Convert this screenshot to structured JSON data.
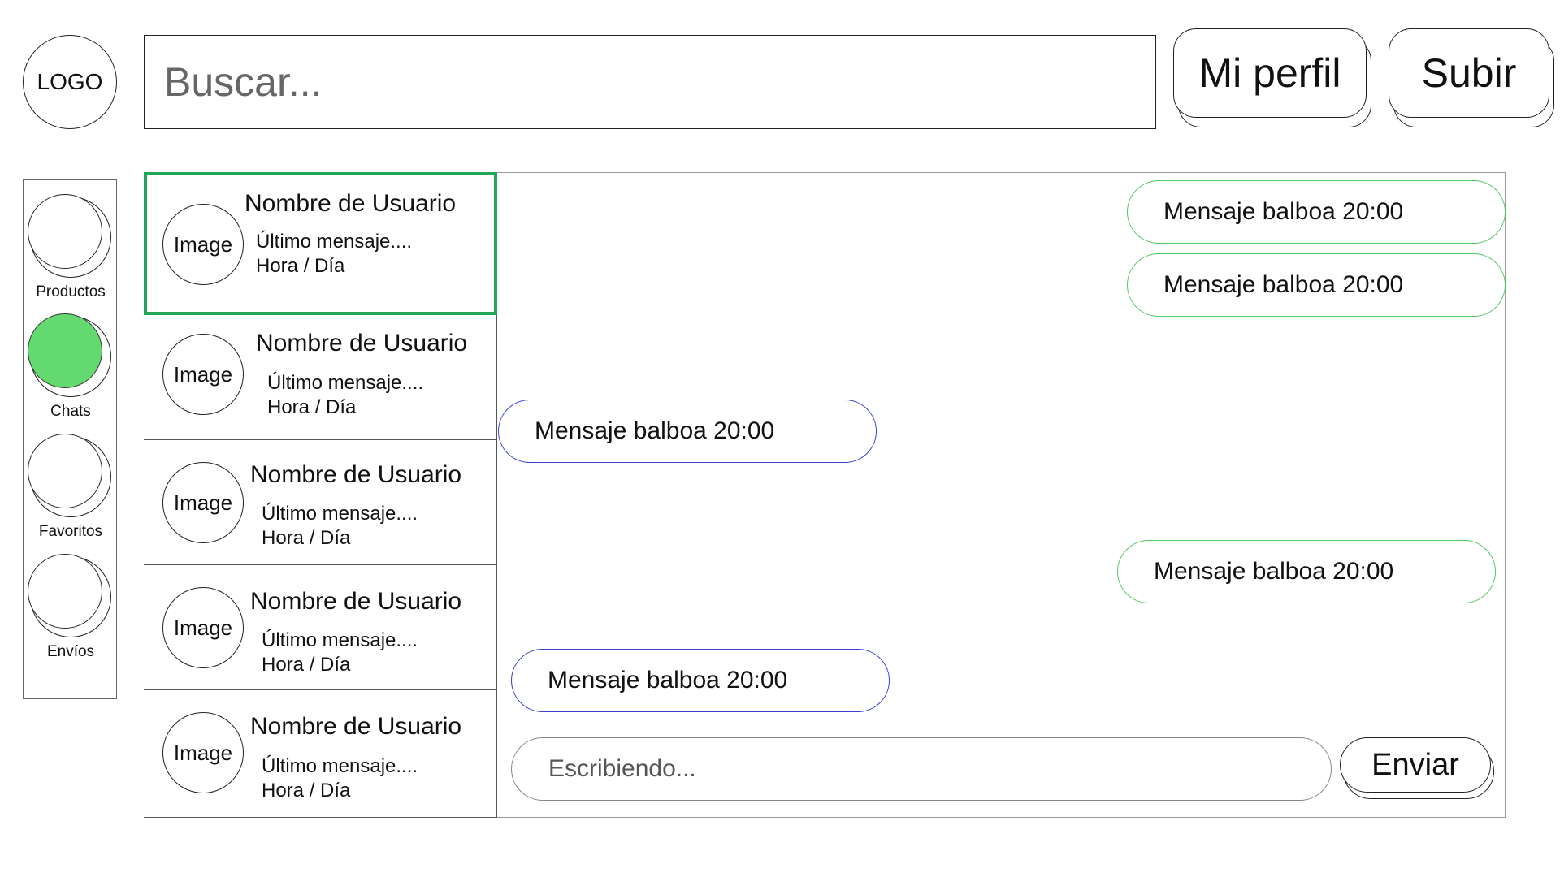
{
  "header": {
    "logo": "LOGO",
    "search_placeholder": "Buscar...",
    "profile_button": "Mi perfil",
    "upload_button": "Subir"
  },
  "sidebar": {
    "items": [
      {
        "label": "Productos",
        "active": false,
        "icon": "circle-icon"
      },
      {
        "label": "Chats",
        "active": true,
        "icon": "circle-icon"
      },
      {
        "label": "Favoritos",
        "active": false,
        "icon": "circle-icon"
      },
      {
        "label": "Envíos",
        "active": false,
        "icon": "circle-icon"
      }
    ]
  },
  "chats": [
    {
      "avatar": "Image",
      "name": "Nombre de Usuario",
      "last_message": "Último mensaje....",
      "time": "Hora / Día",
      "selected": true
    },
    {
      "avatar": "Image",
      "name": "Nombre de Usuario",
      "last_message": "Último mensaje....",
      "time": "Hora / Día",
      "selected": false
    },
    {
      "avatar": "Image",
      "name": "Nombre de Usuario",
      "last_message": "Último mensaje....",
      "time": "Hora / Día",
      "selected": false
    },
    {
      "avatar": "Image",
      "name": "Nombre de Usuario",
      "last_message": "Último mensaje....",
      "time": "Hora / Día",
      "selected": false
    },
    {
      "avatar": "Image",
      "name": "Nombre de Usuario",
      "last_message": "Último mensaje....",
      "time": "Hora / Día",
      "selected": false
    }
  ],
  "messages": [
    {
      "text": "Mensaje balboa 20:00",
      "direction": "outgoing"
    },
    {
      "text": "Mensaje balboa 20:00",
      "direction": "outgoing"
    },
    {
      "text": "Mensaje balboa 20:00",
      "direction": "incoming"
    },
    {
      "text": "Mensaje balboa 20:00",
      "direction": "outgoing"
    },
    {
      "text": "Mensaje balboa 20:00",
      "direction": "incoming"
    }
  ],
  "composer": {
    "placeholder": "Escribiendo...",
    "send_button": "Enviar"
  },
  "colors": {
    "selected_border": "#21a658",
    "active_nav": "#63d96f",
    "outgoing_border": "#4fc95f",
    "incoming_border": "#3a3fd4"
  }
}
